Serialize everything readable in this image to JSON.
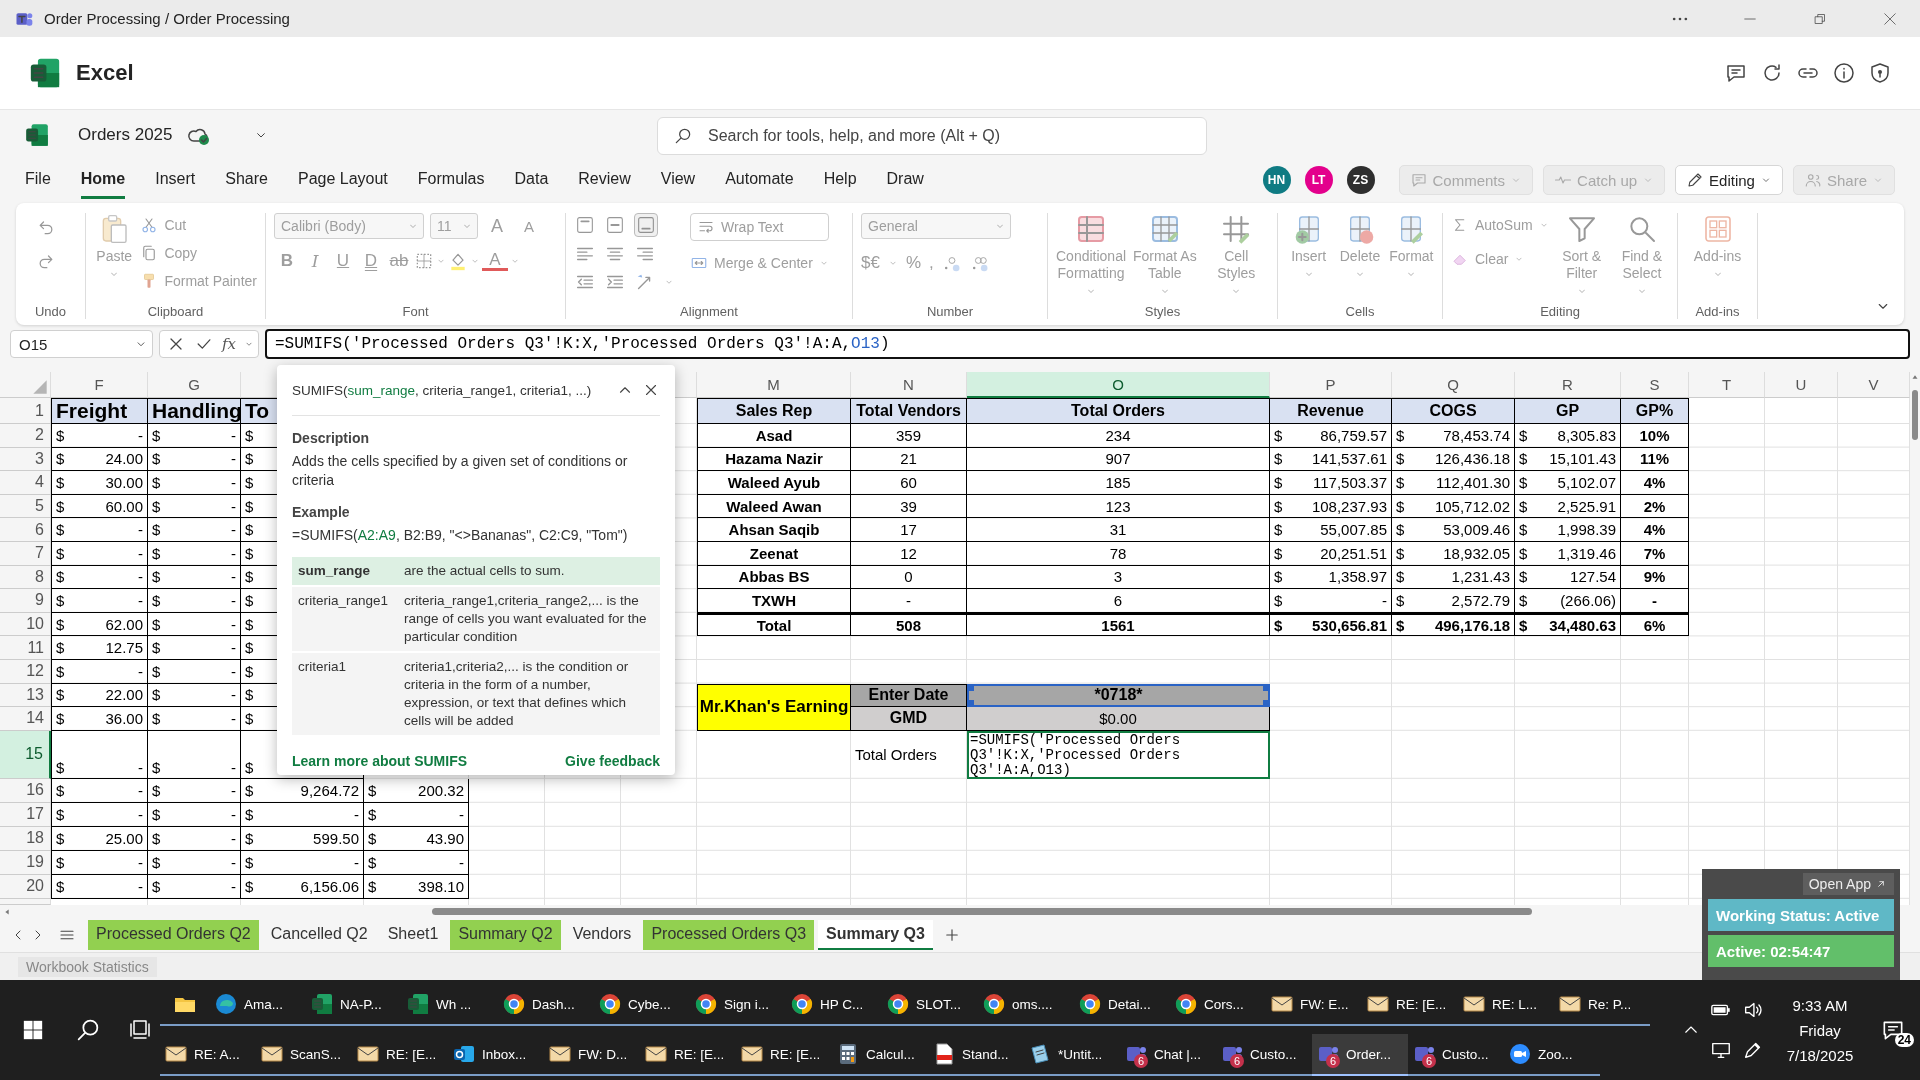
{
  "title_bar": {
    "title": "Order Processing / Order Processing"
  },
  "app": {
    "name": "Excel"
  },
  "document": {
    "name": "Orders 2025",
    "search": {
      "placeholder": "Search for tools, help, and more (Alt + Q)"
    }
  },
  "menu_tabs": [
    {
      "label": "File",
      "selected": false
    },
    {
      "label": "Home",
      "selected": true
    },
    {
      "label": "Insert",
      "selected": false
    },
    {
      "label": "Share",
      "selected": false
    },
    {
      "label": "Page Layout",
      "selected": false
    },
    {
      "label": "Formulas",
      "selected": false
    },
    {
      "label": "Data",
      "selected": false
    },
    {
      "label": "Review",
      "selected": false
    },
    {
      "label": "View",
      "selected": false
    },
    {
      "label": "Automate",
      "selected": false
    },
    {
      "label": "Help",
      "selected": false
    },
    {
      "label": "Draw",
      "selected": false
    }
  ],
  "collaborators": [
    {
      "initials": "HN",
      "color": "#0f7b83"
    },
    {
      "initials": "LT",
      "color": "#e3008c"
    },
    {
      "initials": "ZS",
      "color": "#2e2e2e"
    }
  ],
  "header_buttons": [
    {
      "label": "Comments",
      "kind": "comments",
      "disabled": true
    },
    {
      "label": "Catch up",
      "kind": "catchup",
      "disabled": true
    },
    {
      "label": "Editing",
      "kind": "editing",
      "disabled": false
    },
    {
      "label": "Share",
      "kind": "share",
      "disabled": true
    }
  ],
  "ribbon": {
    "disabled": true,
    "groups": [
      {
        "label": "Undo",
        "kind": "undo"
      },
      {
        "label": "Clipboard",
        "kind": "clipboard",
        "large": [
          {
            "label": "Paste",
            "kind": "paste"
          }
        ],
        "small": [
          {
            "label": "Cut",
            "kind": "cut"
          },
          {
            "label": "Copy",
            "kind": "copy"
          },
          {
            "label": "Format Painter",
            "kind": "painter"
          }
        ]
      },
      {
        "label": "Font",
        "kind": "font",
        "font_name": "Calibri (Body)",
        "font_size": "11",
        "size_buttons": [
          "A",
          "A"
        ],
        "style_buttons": [
          "B",
          "I",
          "U",
          "D",
          "ab"
        ],
        "font_color_letter": "A"
      },
      {
        "label": "Alignment",
        "kind": "alignment",
        "small": [
          {
            "label": "Wrap Text",
            "kind": "wrap"
          },
          {
            "label": "Merge & Center",
            "kind": "merge"
          }
        ]
      },
      {
        "label": "Number",
        "kind": "number",
        "format": "General",
        "symbols": [
          "$€",
          "%",
          ","
        ]
      },
      {
        "label": "Styles",
        "kind": "large",
        "large": [
          {
            "label": "Conditional Formatting",
            "kind": "conditional"
          },
          {
            "label": "Format As Table",
            "kind": "table"
          },
          {
            "label": "Cell Styles",
            "kind": "cellstyles"
          }
        ]
      },
      {
        "label": "Cells",
        "kind": "large",
        "large": [
          {
            "label": "Insert",
            "kind": "insert"
          },
          {
            "label": "Delete",
            "kind": "delete"
          },
          {
            "label": "Format",
            "kind": "format"
          }
        ]
      },
      {
        "label": "Editing",
        "kind": "editing",
        "small": [
          {
            "label": "AutoSum",
            "kind": "sum"
          },
          {
            "label": "Clear",
            "kind": "eraser"
          }
        ],
        "large": [
          {
            "label": "Sort & Filter",
            "kind": "sort"
          },
          {
            "label": "Find & Select",
            "kind": "find"
          }
        ]
      },
      {
        "label": "Add-ins",
        "kind": "large",
        "large": [
          {
            "label": "Add-ins",
            "kind": "addins"
          }
        ]
      }
    ]
  },
  "formula_bar": {
    "name_box": "O15",
    "function_label": "fx",
    "formula_parts": [
      {
        "text": "=SUMIFS('Processed Orders Q3'!K:X,'Processed Orders Q3'!A:A,",
        "color": "#000000"
      },
      {
        "text": "O13",
        "color": "#2a63c5"
      },
      {
        "text": ")",
        "color": "#000000"
      }
    ]
  },
  "sheet": {
    "columns": [
      {
        "letter": "F",
        "selected": false
      },
      {
        "letter": "G",
        "selected": false
      },
      {
        "letter": "M",
        "selected": false
      },
      {
        "letter": "N",
        "selected": false
      },
      {
        "letter": "O",
        "selected": true
      },
      {
        "letter": "P",
        "selected": false
      },
      {
        "letter": "Q",
        "selected": false
      },
      {
        "letter": "R",
        "selected": false
      },
      {
        "letter": "S",
        "selected": false
      },
      {
        "letter": "T",
        "selected": false
      },
      {
        "letter": "U",
        "selected": false
      },
      {
        "letter": "V",
        "selected": false
      }
    ],
    "rows": [
      {
        "number": "1",
        "selected": false
      },
      {
        "number": "2",
        "selected": false
      },
      {
        "number": "3",
        "selected": false
      },
      {
        "number": "4",
        "selected": false
      },
      {
        "number": "5",
        "selected": false
      },
      {
        "number": "6",
        "selected": false
      },
      {
        "number": "7",
        "selected": false
      },
      {
        "number": "8",
        "selected": false
      },
      {
        "number": "9",
        "selected": false
      },
      {
        "number": "10",
        "selected": false
      },
      {
        "number": "11",
        "selected": false
      },
      {
        "number": "12",
        "selected": false
      },
      {
        "number": "13",
        "selected": false
      },
      {
        "number": "14",
        "selected": false
      },
      {
        "number": "15",
        "selected": true
      },
      {
        "number": "16",
        "selected": false
      },
      {
        "number": "17",
        "selected": false
      },
      {
        "number": "18",
        "selected": false
      },
      {
        "number": "19",
        "selected": false
      },
      {
        "number": "20",
        "selected": false
      }
    ]
  },
  "left_table": {
    "headers": [
      "Freight",
      "Handling",
      "To"
    ],
    "rows": [
      [
        [
          "$",
          "-"
        ],
        [
          "$",
          "-"
        ],
        [
          "$"
        ]
      ],
      [
        [
          "$",
          "24.00"
        ],
        [
          "$",
          "-"
        ],
        [
          "$"
        ]
      ],
      [
        [
          "$",
          "30.00"
        ],
        [
          "$",
          "-"
        ],
        [
          "$"
        ]
      ],
      [
        [
          "$",
          "60.00"
        ],
        [
          "$",
          "-"
        ],
        [
          "$"
        ]
      ],
      [
        [
          "$",
          "-"
        ],
        [
          "$",
          "-"
        ],
        [
          "$"
        ]
      ],
      [
        [
          "$",
          "-"
        ],
        [
          "$",
          "-"
        ],
        [
          "$"
        ]
      ],
      [
        [
          "$",
          "-"
        ],
        [
          "$",
          "-"
        ],
        [
          "$"
        ]
      ],
      [
        [
          "$",
          "-"
        ],
        [
          "$",
          "-"
        ],
        [
          "$"
        ]
      ],
      [
        [
          "$",
          "62.00"
        ],
        [
          "$",
          "-"
        ],
        [
          "$"
        ]
      ],
      [
        [
          "$",
          "12.75"
        ],
        [
          "$",
          "-"
        ],
        [
          "$"
        ]
      ],
      [
        [
          "$",
          "-"
        ],
        [
          "$",
          "-"
        ],
        [
          "$"
        ]
      ],
      [
        [
          "$",
          "22.00"
        ],
        [
          "$",
          "-"
        ],
        [
          "$"
        ]
      ],
      [
        [
          "$",
          "36.00"
        ],
        [
          "$",
          "-"
        ],
        [
          "$"
        ]
      ],
      [
        [
          "$",
          "-"
        ],
        [
          "$",
          "-"
        ],
        [
          "$"
        ]
      ],
      [
        [
          "$",
          "-"
        ],
        [
          "$",
          "-"
        ],
        [
          "$",
          "9,264.72"
        ],
        [
          "$",
          "200.32"
        ]
      ],
      [
        [
          "$",
          "-"
        ],
        [
          "$",
          "-"
        ],
        [
          "$",
          "-"
        ],
        [
          "$",
          "-"
        ]
      ],
      [
        [
          "$",
          "25.00"
        ],
        [
          "$",
          "-"
        ],
        [
          "$",
          "599.50"
        ],
        [
          "$",
          "43.90"
        ]
      ],
      [
        [
          "$",
          "-"
        ],
        [
          "$",
          "-"
        ],
        [
          "$",
          "-"
        ],
        [
          "$",
          "-"
        ]
      ],
      [
        [
          "$",
          "-"
        ],
        [
          "$",
          "-"
        ],
        [
          "$",
          "6,156.06"
        ],
        [
          "$",
          "398.10"
        ]
      ]
    ]
  },
  "summary_table": {
    "columns": [
      "Sales Rep",
      "Total Vendors",
      "Total Orders",
      "Revenue",
      "COGS",
      "GP",
      "GP%"
    ],
    "rows": [
      {
        "kind": "data",
        "cells": [
          "Asad",
          "359",
          "234",
          [
            "$",
            "86,759.57"
          ],
          [
            "$",
            "78,453.74"
          ],
          [
            "$",
            "8,305.83"
          ],
          "10%"
        ]
      },
      {
        "kind": "data",
        "cells": [
          "Hazama Nazir",
          "21",
          "907",
          [
            "$",
            "141,537.61"
          ],
          [
            "$",
            "126,436.18"
          ],
          [
            "$",
            "15,101.43"
          ],
          "11%"
        ]
      },
      {
        "kind": "data",
        "cells": [
          "Waleed Ayub",
          "60",
          "185",
          [
            "$",
            "117,503.37"
          ],
          [
            "$",
            "112,401.30"
          ],
          [
            "$",
            "5,102.07"
          ],
          "4%"
        ]
      },
      {
        "kind": "data",
        "cells": [
          "Waleed Awan",
          "39",
          "123",
          [
            "$",
            "108,237.93"
          ],
          [
            "$",
            "105,712.02"
          ],
          [
            "$",
            "2,525.91"
          ],
          "2%"
        ]
      },
      {
        "kind": "data",
        "cells": [
          "Ahsan Saqib",
          "17",
          "31",
          [
            "$",
            "55,007.85"
          ],
          [
            "$",
            "53,009.46"
          ],
          [
            "$",
            "1,998.39"
          ],
          "4%"
        ]
      },
      {
        "kind": "data",
        "cells": [
          "Zeenat",
          "12",
          "78",
          [
            "$",
            "20,251.51"
          ],
          [
            "$",
            "18,932.05"
          ],
          [
            "$",
            "1,319.46"
          ],
          "7%"
        ]
      },
      {
        "kind": "data",
        "cells": [
          "Abbas BS",
          "0",
          "3",
          [
            "$",
            "1,358.97"
          ],
          [
            "$",
            "1,231.43"
          ],
          [
            "$",
            "127.54"
          ],
          "9%"
        ]
      },
      {
        "kind": "data",
        "cells": [
          "TXWH",
          "-",
          "6",
          [
            "$",
            "-"
          ],
          [
            "$",
            "2,572.79"
          ],
          [
            "$",
            "(266.06)"
          ],
          "-"
        ]
      },
      {
        "kind": "total",
        "cells": [
          "Total",
          "508",
          "1561",
          [
            "$",
            "530,656.81"
          ],
          [
            "$",
            "496,176.18"
          ],
          [
            "$",
            "34,480.63"
          ],
          "6%"
        ]
      }
    ]
  },
  "earning": {
    "title": "Mr.Khan's Earning",
    "fields": [
      {
        "label": "Enter Date",
        "value": "*0718*",
        "highlighted": true
      },
      {
        "label": "GMD",
        "value": "$0.00",
        "highlighted": false
      }
    ],
    "total_orders": {
      "label": "Total Orders",
      "formula": "=SUMIFS('Processed Orders Q3'!K:X,'Processed Orders Q3'!A:A,O13)"
    }
  },
  "function_tooltip": {
    "signature_parts": [
      {
        "text": "SUMIFS(",
        "active": false
      },
      {
        "text": "sum_range",
        "active": true
      },
      {
        "text": ", criteria_range1, criteria1, ...)",
        "active": false
      }
    ],
    "description_heading": "Description",
    "description": "Adds the cells specified by a given set of conditions or criteria",
    "example_heading": "Example",
    "example_parts": [
      {
        "text": "=SUMIFS(",
        "active": false
      },
      {
        "text": "A2:A9",
        "active": true
      },
      {
        "text": ", B2:B9, \"<>Bananas\", C2:C9, \"Tom\")",
        "active": false
      }
    ],
    "arguments": [
      {
        "name": "sum_range",
        "text": "are the actual cells to sum.",
        "selected": true
      },
      {
        "name": "criteria_range1",
        "text": "criteria_range1,criteria_range2,... is the range of cells you want evaluated for the particular condition",
        "selected": false
      },
      {
        "name": "criteria1",
        "text": "criteria1,criteria2,... is the condition or criteria in the form of a number, expression, or text that defines which cells will be added",
        "selected": false
      }
    ],
    "links": [
      "Learn more about SUMIFS",
      "Give feedback"
    ]
  },
  "sheet_tabs": [
    {
      "label": "Processed Orders Q2",
      "color": "#92d050",
      "selected": false
    },
    {
      "label": "Cancelled Q2",
      "selected": false
    },
    {
      "label": "Sheet1",
      "selected": false
    },
    {
      "label": "Summary Q2",
      "color": "#92d050",
      "selected": false
    },
    {
      "label": "Vendors",
      "selected": false
    },
    {
      "label": "Processed Orders Q3",
      "color": "#92d050",
      "selected": false
    },
    {
      "label": "Summary Q3",
      "selected": true
    }
  ],
  "status_bar": {
    "label": "Workbook Statistics"
  },
  "status_widget": {
    "open_app": "Open App",
    "status": "Working Status: Active",
    "timer": "Active: 02:54:47"
  },
  "taskbar": {
    "rows": [
      [
        {
          "kind": "folder",
          "selected": false
        },
        {
          "label": "Ama...",
          "kind": "edge",
          "selected": false
        },
        {
          "label": "NA-P...",
          "kind": "excel",
          "selected": false
        },
        {
          "label": "Wh ...",
          "kind": "excel",
          "selected": false
        },
        {
          "label": "Dash...",
          "kind": "chrome",
          "selected": false
        },
        {
          "label": "Cybe...",
          "kind": "chrome",
          "selected": false
        },
        {
          "label": "Sign i...",
          "kind": "chrome",
          "selected": false
        },
        {
          "label": "HP C...",
          "kind": "chrome",
          "selected": false
        },
        {
          "label": "SLOT...",
          "kind": "chrome",
          "selected": false
        },
        {
          "label": "oms....",
          "kind": "chrome",
          "selected": false
        },
        {
          "label": "Detai...",
          "kind": "chrome",
          "selected": false
        },
        {
          "label": "Cors...",
          "kind": "chrome",
          "selected": false
        },
        {
          "label": "FW: E...",
          "kind": "mail",
          "selected": false
        },
        {
          "label": "RE: [E...",
          "kind": "mail",
          "selected": false
        },
        {
          "label": "RE: L...",
          "kind": "mail",
          "selected": false
        },
        {
          "label": "Re: P...",
          "kind": "mail",
          "selected": false
        }
      ],
      [
        {
          "label": "RE: A...",
          "kind": "mail",
          "selected": false
        },
        {
          "label": "ScanS...",
          "kind": "mail",
          "selected": false
        },
        {
          "label": "RE: [E...",
          "kind": "mail",
          "selected": false
        },
        {
          "label": "Inbox...",
          "kind": "outlook",
          "selected": false
        },
        {
          "label": "FW: D...",
          "kind": "mail",
          "selected": false
        },
        {
          "label": "RE: [E...",
          "kind": "mail",
          "selected": false
        },
        {
          "label": "RE: [E...",
          "kind": "mail",
          "selected": false
        },
        {
          "label": "Calcul...",
          "kind": "calculator",
          "selected": false
        },
        {
          "label": "Stand...",
          "kind": "pdf",
          "selected": false
        },
        {
          "label": "*Untit...",
          "kind": "notepad",
          "selected": false
        },
        {
          "label": "Chat |...",
          "kind": "teams",
          "badge": "6",
          "selected": false
        },
        {
          "label": "Custo...",
          "kind": "teams",
          "badge": "6",
          "selected": false
        },
        {
          "label": "Order...",
          "kind": "teams",
          "badge": "6",
          "selected": true
        },
        {
          "label": "Custo...",
          "kind": "teams",
          "badge": "6",
          "selected": false
        },
        {
          "label": "Zoo...",
          "kind": "zoom",
          "selected": false
        }
      ]
    ],
    "clock": {
      "time": "9:33 AM",
      "day": "Friday",
      "date": "7/18/2025"
    },
    "notifications": "24"
  }
}
